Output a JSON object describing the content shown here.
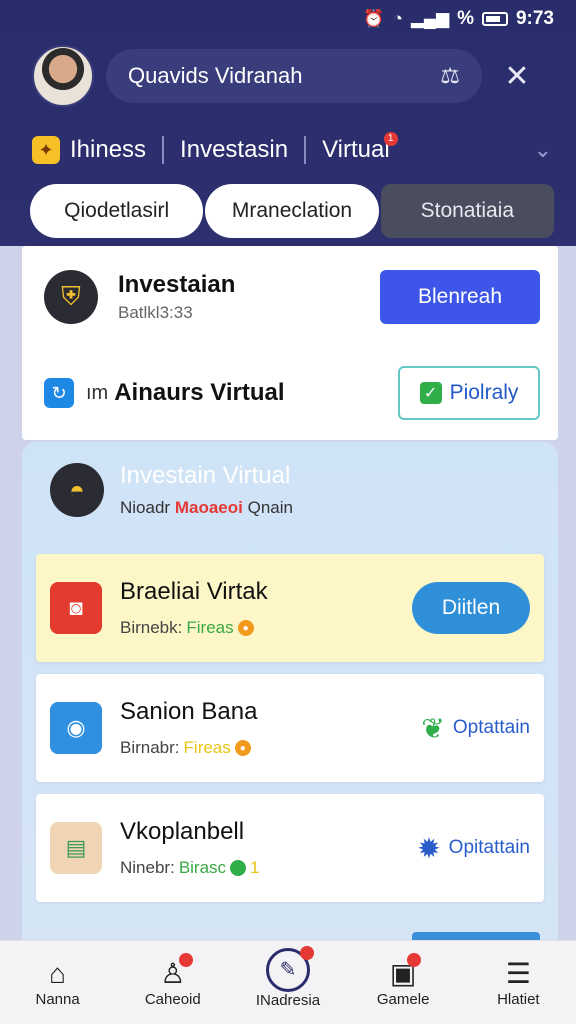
{
  "status_bar": {
    "time": "9:73",
    "percent": "%"
  },
  "header": {
    "search_title": "Quavids Vidranah"
  },
  "tabs": [
    {
      "label": "Ihiness"
    },
    {
      "label": "Investasin"
    },
    {
      "label": "Virtual",
      "badge": "1"
    }
  ],
  "segments": [
    {
      "label": "Qiodetlasirl"
    },
    {
      "label": "Mraneclation"
    },
    {
      "label": "Stonatiaia"
    }
  ],
  "card1": {
    "row1": {
      "title": "Investaian",
      "subtitle": "Batlkl3:33",
      "button": "Blenreah"
    },
    "row2": {
      "prefix": "ım",
      "title": "Ainaurs Virtual",
      "button": "Piolraly"
    }
  },
  "panel": {
    "title": "Investain Virtual",
    "sub_a": "Nioadr",
    "sub_b": "Maoaeoi",
    "sub_c": "Qnain",
    "items": [
      {
        "title": "Braeliai Virtak",
        "sub_label": "Birnebk:",
        "sub_value": "Fireas",
        "action": "Diitlen"
      },
      {
        "title": "Sanion Bana",
        "sub_label": "Birnabr:",
        "sub_value": "Fireas",
        "action": "Optattain"
      },
      {
        "title": "Vkoplanbell",
        "sub_label": "Ninebr:",
        "sub_value": "Birasc",
        "badge": "1",
        "action": "Opitattain"
      }
    ]
  },
  "bottom_nav": [
    {
      "label": "Nanna"
    },
    {
      "label": "Caheoid"
    },
    {
      "label": "INadresia"
    },
    {
      "label": "Gamele"
    },
    {
      "label": "Hlatiet"
    }
  ],
  "colors": {
    "primary": "#2a2d6b",
    "accent_blue": "#3d55e8",
    "badge_red": "#e53935"
  }
}
